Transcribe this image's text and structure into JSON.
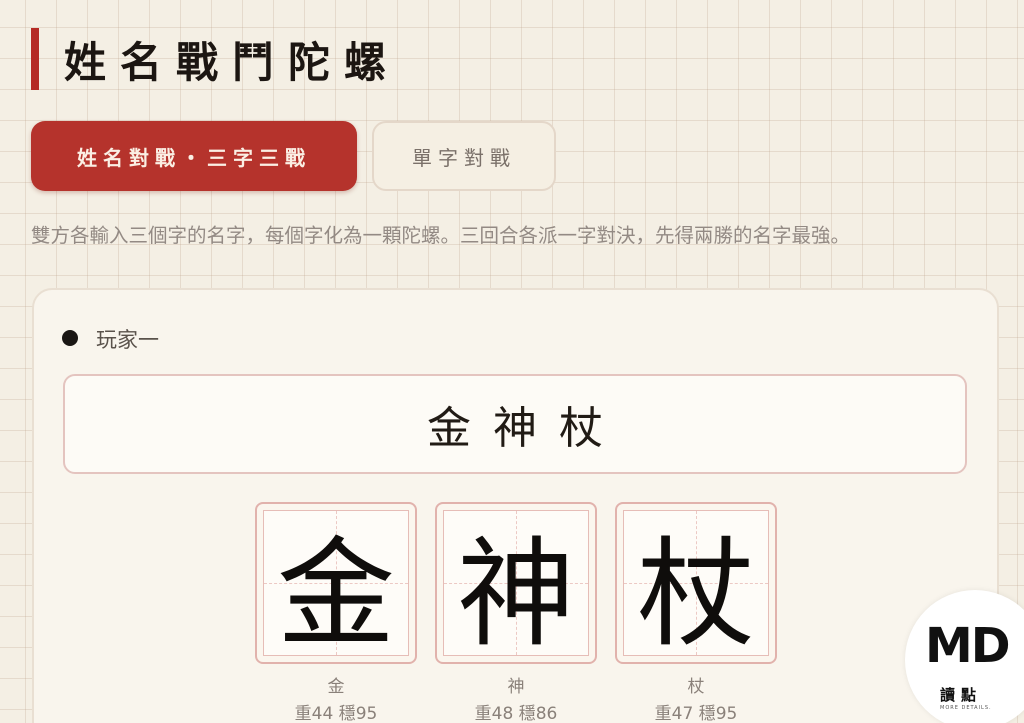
{
  "header": {
    "title": "姓名戰鬥陀螺"
  },
  "tabs": [
    {
      "label": "姓名對戰・三字三戰",
      "active": true
    },
    {
      "label": "單字對戰",
      "active": false
    }
  ],
  "description": "雙方各輸入三個字的名字，每個字化為一顆陀螺。三回合各派一字對決，先得兩勝的名字最強。",
  "player1": {
    "label": "玩家一",
    "name_value": "金神杖",
    "tiles": [
      {
        "char": "金",
        "stats": "重44 穩95"
      },
      {
        "char": "神",
        "stats": "重48 穩86"
      },
      {
        "char": "杖",
        "stats": "重47 穩95"
      }
    ]
  },
  "watermark": {
    "logo": "MD",
    "chinese": "讀點",
    "tagline": "MORE DETAILS."
  },
  "colors": {
    "accent": "#b5332c",
    "background": "#f4efe4",
    "tile_border": "#e1b2ac"
  }
}
